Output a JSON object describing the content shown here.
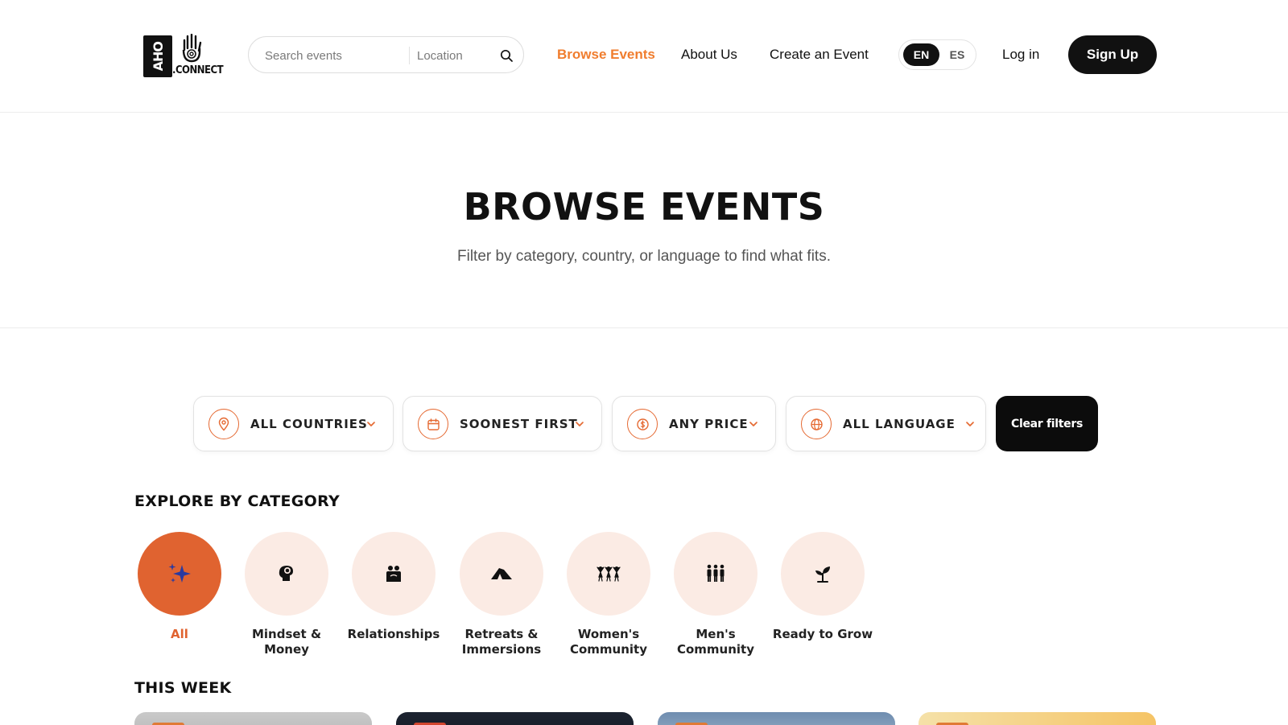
{
  "header": {
    "logo_text": ".CONNECT",
    "logo_mark": "AHO",
    "search_placeholder": "Search events",
    "location_placeholder": "Location",
    "nav": [
      {
        "label": "Browse Events",
        "active": true
      },
      {
        "label": "About Us",
        "active": false
      },
      {
        "label": "Create an Event",
        "active": false
      }
    ],
    "lang": {
      "en": "EN",
      "es": "ES",
      "selected": "EN"
    },
    "login_label": "Log in",
    "signup_label": "Sign Up"
  },
  "hero": {
    "title": "BROWSE EVENTS",
    "subtitle": "Filter by category, country, or language to find what fits."
  },
  "filters": [
    {
      "label": "ALL COUNTRIES",
      "icon": "location-pin-icon"
    },
    {
      "label": "SOONEST FIRST",
      "icon": "calendar-icon"
    },
    {
      "label": "ANY PRICE",
      "icon": "price-icon"
    },
    {
      "label": "ALL LANGUAGES",
      "icon": "globe-icon"
    }
  ],
  "clear_filters_label": "Clear filters",
  "categories_title": "EXPLORE BY CATEGORY",
  "categories": [
    {
      "label": "All",
      "icon": "sparkles-icon",
      "active": true
    },
    {
      "label": "Mindset & Money",
      "icon": "mind-icon",
      "active": false
    },
    {
      "label": "Relationships",
      "icon": "people-icon",
      "active": false
    },
    {
      "label": "Retreats & Immersions",
      "icon": "tent-icon",
      "active": false
    },
    {
      "label": "Women's Community",
      "icon": "women-group-icon",
      "active": false
    },
    {
      "label": "Men's Community",
      "icon": "men-group-icon",
      "active": false
    },
    {
      "label": "Ready to Grow",
      "icon": "sprout-icon",
      "active": false
    }
  ],
  "this_week_title": "THIS WEEK",
  "colors": {
    "accent": "#e06330",
    "nav_active": "#f07d2e",
    "category_bg": "#fbebe4",
    "dark": "#111111"
  }
}
